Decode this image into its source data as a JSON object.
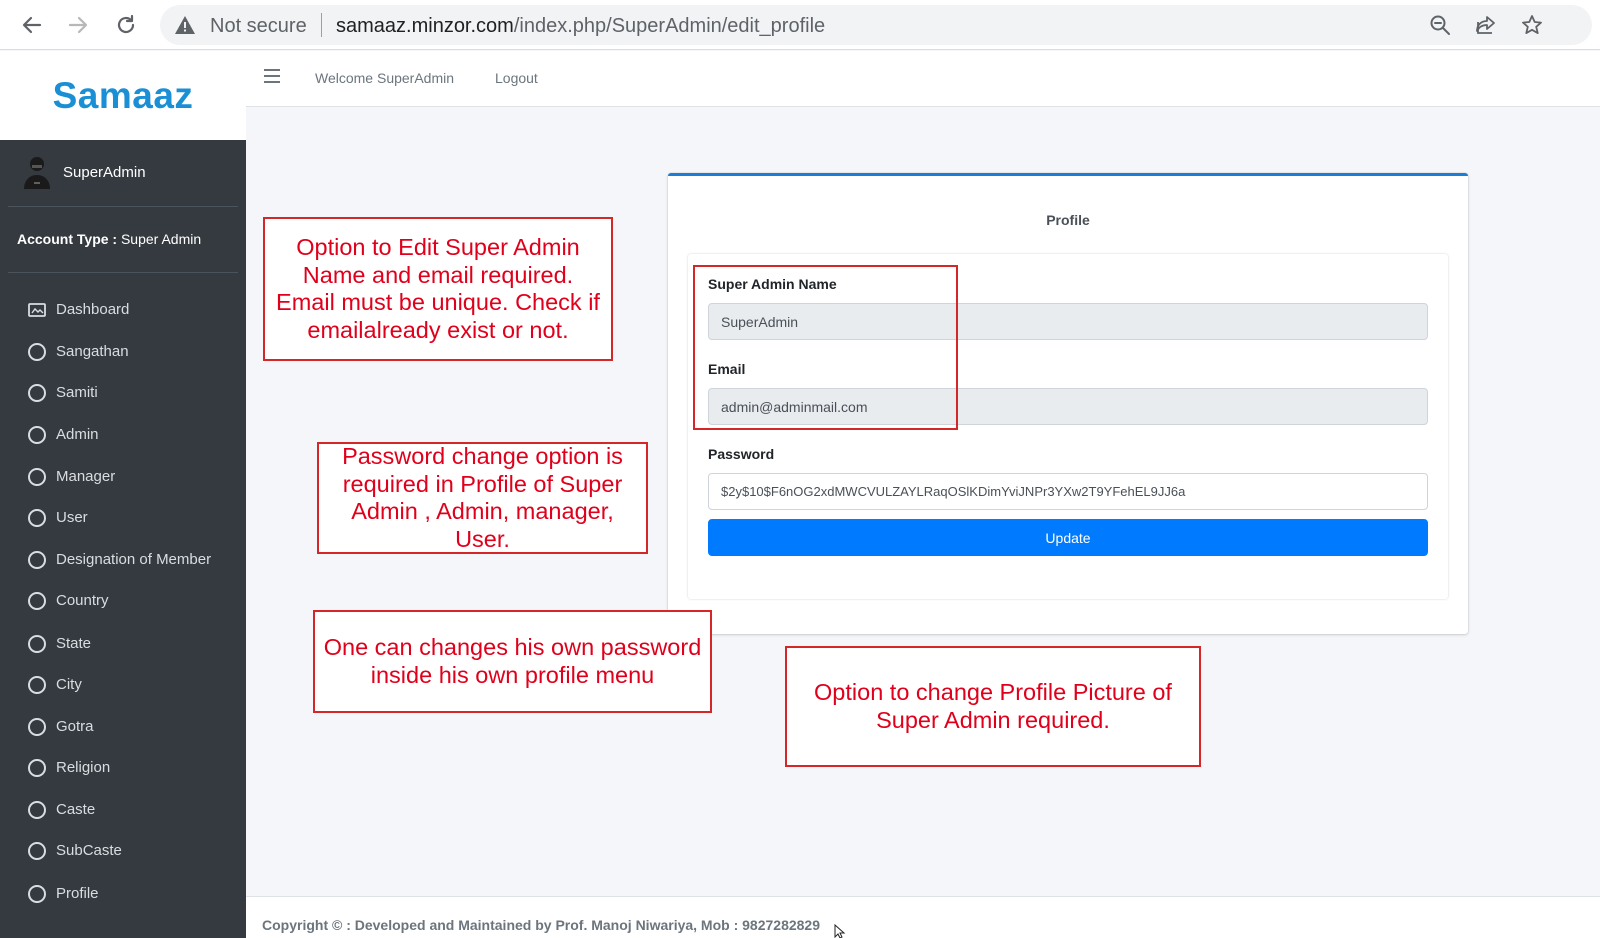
{
  "browser": {
    "security_label": "Not secure",
    "url_host": "samaaz.minzor.com",
    "url_path": "/index.php/SuperAdmin/edit_profile"
  },
  "brand": {
    "name": "Samaaz",
    "color": "#1a8fd6"
  },
  "user": {
    "name": "SuperAdmin"
  },
  "account": {
    "label": "Account Type :",
    "value": "Super Admin"
  },
  "sidebar": {
    "items": [
      {
        "label": "Dashboard",
        "icon": "dashboard-icon"
      },
      {
        "label": "Sangathan",
        "icon": "circle-icon"
      },
      {
        "label": "Samiti",
        "icon": "circle-icon"
      },
      {
        "label": "Admin",
        "icon": "circle-icon"
      },
      {
        "label": "Manager",
        "icon": "circle-icon"
      },
      {
        "label": "User",
        "icon": "circle-icon"
      },
      {
        "label": "Designation of Member",
        "icon": "circle-icon"
      },
      {
        "label": "Country",
        "icon": "circle-icon"
      },
      {
        "label": "State",
        "icon": "circle-icon"
      },
      {
        "label": "City",
        "icon": "circle-icon"
      },
      {
        "label": "Gotra",
        "icon": "circle-icon"
      },
      {
        "label": "Religion",
        "icon": "circle-icon"
      },
      {
        "label": "Caste",
        "icon": "circle-icon"
      },
      {
        "label": "SubCaste",
        "icon": "circle-icon"
      },
      {
        "label": "Profile",
        "icon": "circle-icon"
      }
    ]
  },
  "topnav": {
    "welcome": "Welcome  SuperAdmin",
    "logout": "Logout"
  },
  "profile": {
    "title": "Profile",
    "name_label": "Super Admin Name",
    "name_value": "SuperAdmin",
    "email_label": "Email",
    "email_value": "admin@adminmail.com",
    "password_label": "Password",
    "password_value": "$2y$10$F6nOG2xdMWCVULZAYLRaqOSlKDimYviJNPr3YXw2T9YFehEL9JJ6a",
    "update_label": "Update",
    "accent": "#007bff"
  },
  "annotations": {
    "edit_name_email": "Option to Edit Super Admin Name and email required. Email must be unique. Check if emailalready exist or not.",
    "password_change": "Password change option is required in Profile of Super Admin , Admin, manager, User.",
    "own_password": "One can changes his own password inside his own profile menu",
    "profile_picture": "Option to change Profile Picture of Super Admin required."
  },
  "footer": {
    "text": "Copyright © : Developed and Maintained by Prof. Manoj Niwariya, Mob : 9827282829"
  }
}
